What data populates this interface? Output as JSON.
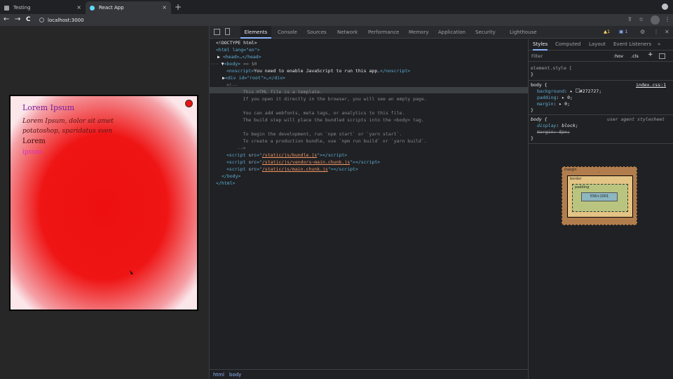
{
  "browser": {
    "tabs": [
      {
        "title": "Testing",
        "close": "×"
      },
      {
        "title": "React App",
        "close": "×"
      }
    ],
    "new_tab": "+",
    "nav": {
      "back": "←",
      "forward": "→",
      "reload": "C"
    },
    "url": "localhost:3000"
  },
  "page": {
    "heading": "Lorem Ipsum",
    "paragraph": "Lorem Ipsum, dolor sit amet potatoshop, sparidatus sven",
    "label": "Lorem",
    "link": "ipsum"
  },
  "devtools": {
    "tabs": [
      "Elements",
      "Console",
      "Sources",
      "Network",
      "Performance",
      "Memory",
      "Application",
      "Security",
      "Lighthouse"
    ],
    "active_tab": "Elements",
    "warnings": "▲1",
    "issues": "1",
    "dom": {
      "doctype": "<!DOCTYPE html>",
      "html_open": "<html lang=\"en\">",
      "head": "<head>…</head>",
      "body_open": "<body>",
      "body_marker": "== $0",
      "noscript_text": "You need to enable JavaScript to run this app.",
      "div_root": "<div id=\"root\">…</div>",
      "comment_lines": [
        "<!--",
        "      This HTML file is a template.",
        "      If you open it directly in the browser, you will see an empty page.",
        "",
        "      You can add webfonts, meta tags, or analytics to this file.",
        "      The build step will place the bundled scripts into the <body> tag.",
        "",
        "      To begin the development, run `npm start` or `yarn start`.",
        "      To create a production bundle, use `npm run build` or `yarn build`.",
        "    -->"
      ],
      "scripts": [
        "/static/js/bundle.js",
        "/static/js/vendors~main.chunk.js",
        "/static/js/main.chunk.js"
      ],
      "body_close": "</body>",
      "html_close": "</html>"
    },
    "breadcrumbs": [
      "html",
      "body"
    ],
    "styles": {
      "tabs": [
        "Styles",
        "Computed",
        "Layout",
        "Event Listeners"
      ],
      "active": "Styles",
      "filter_placeholder": "Filter",
      "hov": ":hov",
      "cls": ".cls",
      "element_style": "element.style {",
      "close_brace": "}",
      "body_rule_selector": "body {",
      "body_rule_source": "index.css:1",
      "body_props": [
        {
          "name": "background",
          "value": "#272727"
        },
        {
          "name": "padding",
          "value": "0"
        },
        {
          "name": "margin",
          "value": "0"
        }
      ],
      "ua_selector": "body {",
      "ua_source": "user agent stylesheet",
      "ua_props": [
        {
          "name": "display",
          "value": "block"
        },
        {
          "name": "margin",
          "value": "8px"
        }
      ],
      "box_model": {
        "margin_label": "margin",
        "border_label": "border",
        "padding_label": "padding",
        "content": "556×1001",
        "dash": "-"
      }
    }
  },
  "colors": {
    "page_background": "#272727",
    "accent": "#8ab4f8"
  }
}
